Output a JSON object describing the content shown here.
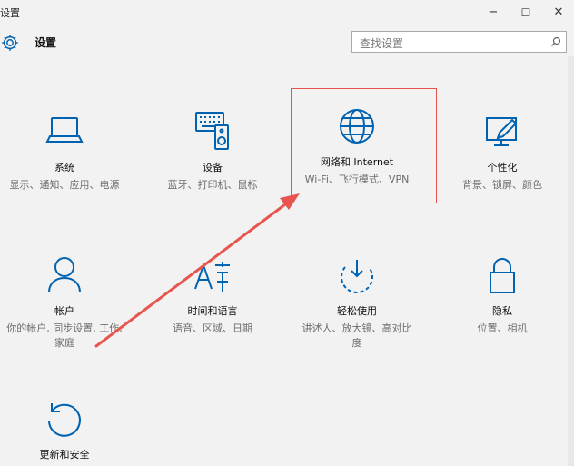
{
  "window": {
    "title": "设置",
    "minimize_glyph": "−",
    "maximize_glyph": "☐",
    "close_glyph": "✕"
  },
  "header": {
    "app_title": "设置"
  },
  "search": {
    "placeholder": "查找设置"
  },
  "colors": {
    "accent": "#0063b1",
    "highlight": "#e8554e",
    "background": "#f2f2f2"
  },
  "tiles": [
    {
      "icon": "laptop-icon",
      "name": "系统",
      "desc": "显示、通知、应用、电源"
    },
    {
      "icon": "keyboard-speaker-icon",
      "name": "设备",
      "desc": "蓝牙、打印机、鼠标"
    },
    {
      "icon": "globe-icon",
      "name": "网络和 Internet",
      "desc": "Wi-Fi、飞行模式、VPN"
    },
    {
      "icon": "paint-display-icon",
      "name": "个性化",
      "desc": "背景、锁屏、颜色"
    },
    {
      "icon": "person-icon",
      "name": "帐户",
      "desc": "你的帐户, 同步设置, 工作, 家庭"
    },
    {
      "icon": "language-icon",
      "name": "时间和语言",
      "desc": "语音、区域、日期"
    },
    {
      "icon": "ease-of-access-icon",
      "name": "轻松使用",
      "desc": "讲述人、放大镜、高对比度"
    },
    {
      "icon": "lock-icon",
      "name": "隐私",
      "desc": "位置、相机"
    },
    {
      "icon": "refresh-icon",
      "name": "更新和安全",
      "desc": ""
    }
  ]
}
